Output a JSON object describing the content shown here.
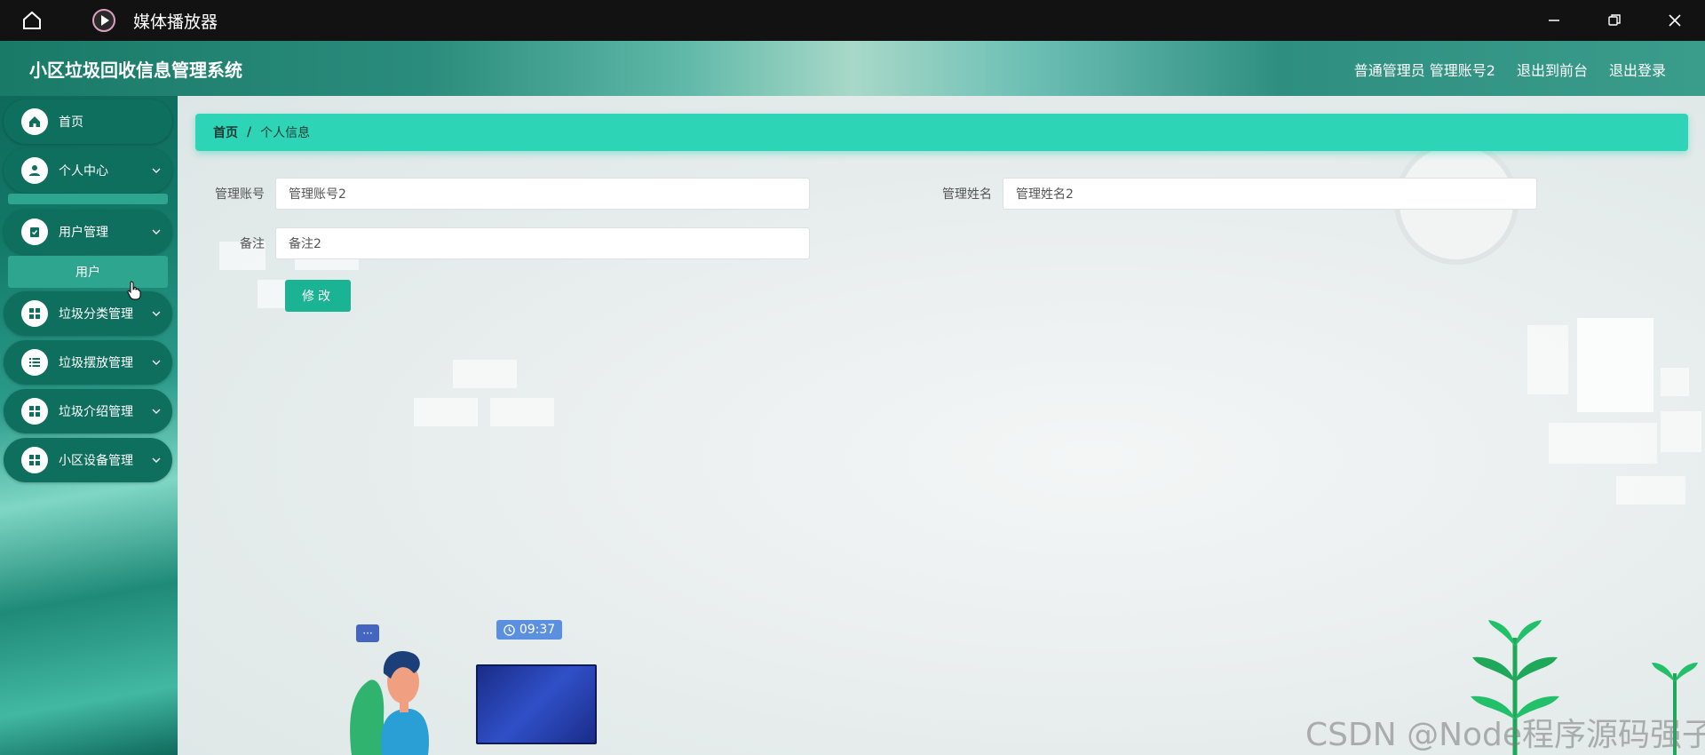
{
  "titlebar": {
    "title": "媒体播放器"
  },
  "header": {
    "app_title": "小区垃圾回收信息管理系统",
    "user_info": "普通管理员 管理账号2",
    "goto_front": "退出到前台",
    "logout": "退出登录"
  },
  "sidebar": {
    "items": [
      {
        "label": "首页",
        "icon": "home-icon"
      },
      {
        "label": "个人中心",
        "icon": "user-icon"
      },
      {
        "label": "用户管理",
        "icon": "clipboard-icon"
      },
      {
        "label": "垃圾分类管理",
        "icon": "grid-icon"
      },
      {
        "label": "垃圾摆放管理",
        "icon": "list-icon"
      },
      {
        "label": "垃圾介绍管理",
        "icon": "grid-icon"
      },
      {
        "label": "小区设备管理",
        "icon": "grid-icon"
      }
    ],
    "sub_user": "用户"
  },
  "breadcrumb": {
    "home": "首页",
    "sep": "/",
    "current": "个人信息"
  },
  "form": {
    "account_label": "管理账号",
    "account_value": "管理账号2",
    "name_label": "管理姓名",
    "name_value": "管理姓名2",
    "note_label": "备注",
    "note_value": "备注2",
    "submit_label": "修改"
  },
  "decor": {
    "clock_time": "09:37",
    "chat_dots": "···"
  },
  "watermark": "CSDN @Node程序源码强子",
  "colors": {
    "accent": "#2dd4b6",
    "button": "#1ab394",
    "menu": "#0f6f5e"
  }
}
